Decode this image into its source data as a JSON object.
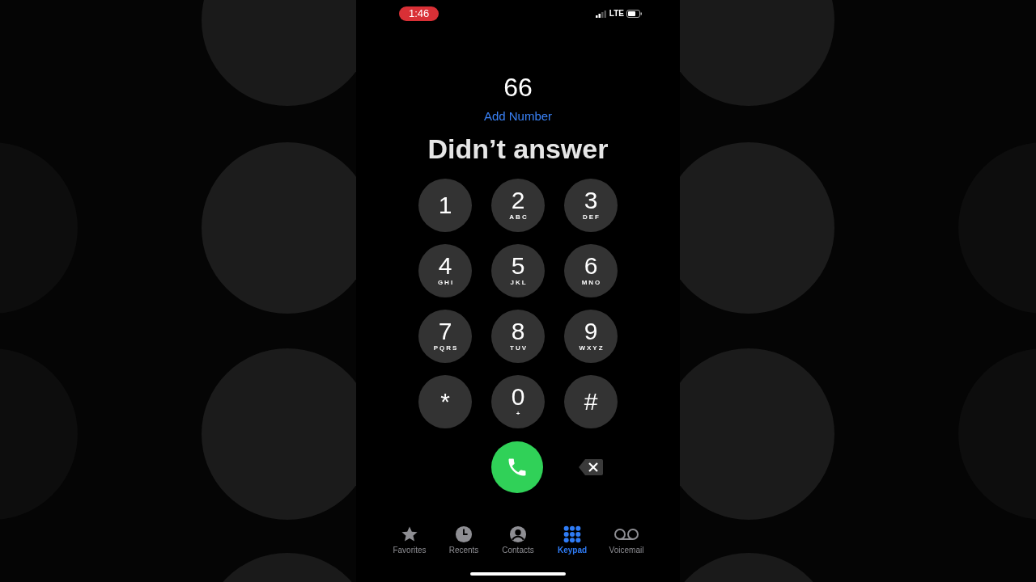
{
  "status_bar": {
    "time": "1:46",
    "network": "LTE"
  },
  "dialed_number": "66",
  "add_number": "Add Number",
  "caption": "Didn’t answer",
  "keys": [
    {
      "digit": "1"
    },
    {
      "digit": "2",
      "letters": "ABC"
    },
    {
      "digit": "3",
      "letters": "DEF"
    },
    {
      "digit": "4",
      "letters": "GHI"
    },
    {
      "digit": "5",
      "letters": "JKL"
    },
    {
      "digit": "6",
      "letters": "MNO"
    },
    {
      "digit": "7",
      "letters": "PQRS"
    },
    {
      "digit": "8",
      "letters": "TUV"
    },
    {
      "digit": "9",
      "letters": "WXYZ"
    },
    {
      "digit": "*"
    },
    {
      "digit": "0",
      "letters": "+"
    },
    {
      "digit": "#"
    }
  ],
  "tabs": [
    {
      "label": "Favorites",
      "kind": "star",
      "selected": false
    },
    {
      "label": "Recents",
      "kind": "clock",
      "selected": false
    },
    {
      "label": "Contacts",
      "kind": "person",
      "selected": false
    },
    {
      "label": "Keypad",
      "kind": "keypad",
      "selected": true
    },
    {
      "label": "Voicemail",
      "kind": "voicemail",
      "selected": false
    }
  ]
}
